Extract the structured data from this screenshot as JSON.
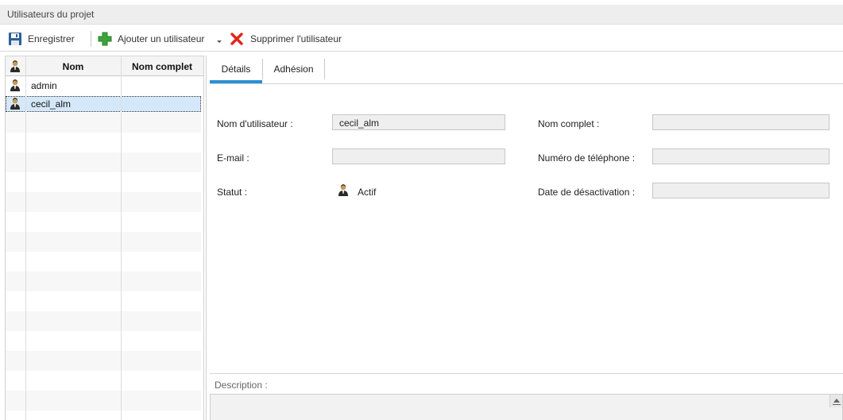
{
  "panel": {
    "title": "Utilisateurs du projet"
  },
  "toolbar": {
    "save_label": "Enregistrer",
    "add_user_label": "Ajouter un utilisateur",
    "delete_user_label": "Supprimer l'utilisateur"
  },
  "user_list": {
    "columns": [
      "Nom",
      "Nom complet"
    ],
    "rows": [
      {
        "name": "admin",
        "full_name": ""
      },
      {
        "name": "cecil_alm",
        "full_name": ""
      }
    ],
    "selected": "cecil_alm"
  },
  "tabs": [
    "Détails",
    "Adhésion"
  ],
  "active_tab": "Détails",
  "details": {
    "username_label": "Nom d'utilisateur :",
    "username_value": "cecil_alm",
    "fullname_label": "Nom complet :",
    "fullname_value": "",
    "email_label": "E-mail :",
    "email_value": "",
    "phone_label": "Numéro de téléphone :",
    "phone_value": "",
    "status_label": "Statut :",
    "status_value": "Actif",
    "deactivation_label": "Date de désactivation :",
    "deactivation_value": ""
  },
  "description": {
    "label": "Description :",
    "value": ""
  },
  "colors": {
    "accent": "#2b8fd6",
    "selected_row": "#d5e8f9",
    "delete_red": "#e0251b",
    "add_green": "#3aa53a"
  },
  "icons": [
    "save-icon",
    "add-user-icon",
    "dropdown-arrow-icon",
    "delete-icon",
    "user-icon"
  ]
}
